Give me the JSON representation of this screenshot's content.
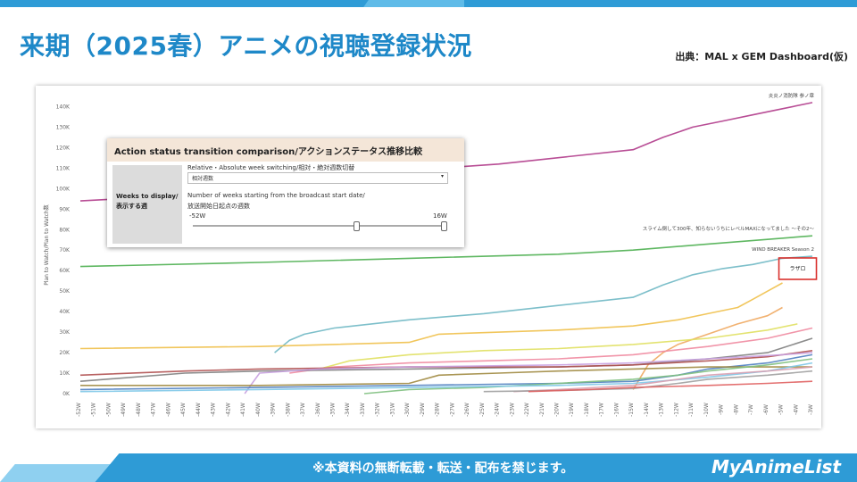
{
  "slide": {
    "title": "来期（2025春）アニメの視聴登録状況",
    "source": "出典：MAL x GEM Dashboard(仮)",
    "footnote": "※本資料の無断転載・転送・配布を禁じます。",
    "brand": "MyAnimeList",
    "accent_color": "#1e88c8",
    "band_color": "#2e9bd6"
  },
  "panel": {
    "title": "Action status transition comparison/アクションステータス推移比較",
    "side_label": "Weeks to display/ 表示する週",
    "switch_label": "Relative・Absolute week switching/相対・絶対週数切替",
    "switch_value": "相対週数",
    "weeks_label_1": "Number of weeks starting from the broadcast start date/",
    "weeks_label_2": "放送開始日起点の週数",
    "range_min": "-52W",
    "range_max": "16W",
    "range_from": -52,
    "range_to": 16
  },
  "chart_data": {
    "type": "line",
    "ylabel": "Plan to Watch/Plan to Watch数",
    "xlabel": "",
    "x": [
      -52,
      -51,
      -50,
      -49,
      -48,
      -47,
      -46,
      -45,
      -44,
      -43,
      -42,
      -41,
      -40,
      -39,
      -38,
      -37,
      -36,
      -35,
      -34,
      -33,
      -32,
      -31,
      -30,
      -29,
      -28,
      -27,
      -26,
      -25,
      -24,
      -23,
      -22,
      -21,
      -20,
      -19,
      -18,
      -17,
      -16,
      -15,
      -14,
      -13,
      -12,
      -11,
      -10,
      -9,
      -8,
      -7,
      -6,
      -5,
      -4,
      -3
    ],
    "x_tick_labels": [
      "-52W",
      "-51W",
      "-50W",
      "-49W",
      "-48W",
      "-47W",
      "-46W",
      "-45W",
      "-44W",
      "-43W",
      "-42W",
      "-41W",
      "-40W",
      "-39W",
      "-38W",
      "-37W",
      "-36W",
      "-35W",
      "-34W",
      "-33W",
      "-32W",
      "-31W",
      "-30W",
      "-29W",
      "-28W",
      "-27W",
      "-26W",
      "-25W",
      "-24W",
      "-23W",
      "-22W",
      "-21W",
      "-20W",
      "-19W",
      "-18W",
      "-17W",
      "-16W",
      "-15W",
      "-14W",
      "-13W",
      "-12W",
      "-11W",
      "-10W",
      "-9W",
      "-8W",
      "-7W",
      "-6W",
      "-5W",
      "-4W",
      "-3W"
    ],
    "y_tick_labels": [
      "0K",
      "10K",
      "20K",
      "30K",
      "40K",
      "50K",
      "60K",
      "70K",
      "80K",
      "90K",
      "100K",
      "110K",
      "120K",
      "130K",
      "140K"
    ],
    "ylim": [
      0,
      145000
    ],
    "grid": false,
    "highlight_box_label": "ラザロ",
    "highlight_color": "#d9302c",
    "series": [
      {
        "name": "炎炎ノ消防隊 参ノ章",
        "color": "#b03a8a",
        "label": "炎炎ノ消防隊 参ノ章",
        "points": [
          [
            -52,
            94000
          ],
          [
            -47,
            96000
          ],
          [
            -40,
            100000
          ],
          [
            -32,
            108000
          ],
          [
            -24,
            112000
          ],
          [
            -15,
            119000
          ],
          [
            -13,
            125000
          ],
          [
            -11,
            130000
          ],
          [
            -9,
            133000
          ],
          [
            -7,
            136000
          ],
          [
            -5,
            139000
          ],
          [
            -3,
            142000
          ]
        ]
      },
      {
        "name": "スライム倒して300年、知らないうちにレベルMAXになってました 〜その2〜",
        "color": "#4caf50",
        "label": "スライム倒して300年、知らないうちにレベルMAXになってました ～その2～",
        "points": [
          [
            -52,
            62000
          ],
          [
            -40,
            64000
          ],
          [
            -30,
            66000
          ],
          [
            -20,
            68000
          ],
          [
            -15,
            70000
          ],
          [
            -10,
            73000
          ],
          [
            -3,
            77000
          ]
        ]
      },
      {
        "name": "WIND BREAKER Season 2",
        "color": "#6fb8c4",
        "label": "WIND BREAKER Season 2",
        "points": [
          [
            -39,
            20000
          ],
          [
            -38,
            26000
          ],
          [
            -37,
            29000
          ],
          [
            -35,
            32000
          ],
          [
            -30,
            36000
          ],
          [
            -25,
            39000
          ],
          [
            -20,
            43000
          ],
          [
            -15,
            47000
          ],
          [
            -13,
            53000
          ],
          [
            -11,
            58000
          ],
          [
            -9,
            61000
          ],
          [
            -7,
            63000
          ],
          [
            -5,
            66000
          ],
          [
            -3,
            67000
          ]
        ]
      },
      {
        "name": "ラザロ",
        "color": "#f0c04a",
        "points": [
          [
            -52,
            22000
          ],
          [
            -40,
            23000
          ],
          [
            -30,
            25000
          ],
          [
            -28,
            29000
          ],
          [
            -20,
            31000
          ],
          [
            -15,
            33000
          ],
          [
            -12,
            36000
          ],
          [
            -10,
            39000
          ],
          [
            -8,
            42000
          ],
          [
            -7,
            46000
          ],
          [
            -6,
            50000
          ],
          [
            -5,
            54000
          ]
        ]
      },
      {
        "name": "",
        "color": "#f0a860",
        "points": [
          [
            -15,
            2000
          ],
          [
            -14,
            14000
          ],
          [
            -13,
            20000
          ],
          [
            -12,
            24000
          ],
          [
            -10,
            29000
          ],
          [
            -8,
            34000
          ],
          [
            -6,
            38000
          ],
          [
            -5,
            42000
          ]
        ]
      },
      {
        "name": "",
        "color": "#e0e060",
        "points": [
          [
            -36,
            12000
          ],
          [
            -34,
            16000
          ],
          [
            -30,
            19000
          ],
          [
            -25,
            21000
          ],
          [
            -20,
            22000
          ],
          [
            -15,
            24000
          ],
          [
            -10,
            27000
          ],
          [
            -6,
            31000
          ],
          [
            -4,
            34000
          ]
        ]
      },
      {
        "name": "",
        "color": "#f08aa0",
        "points": [
          [
            -38,
            10000
          ],
          [
            -35,
            13000
          ],
          [
            -30,
            15000
          ],
          [
            -25,
            16000
          ],
          [
            -20,
            17000
          ],
          [
            -15,
            19000
          ],
          [
            -10,
            23000
          ],
          [
            -6,
            27000
          ],
          [
            -3,
            32000
          ]
        ]
      },
      {
        "name": "",
        "color": "#808080",
        "points": [
          [
            -52,
            6000
          ],
          [
            -45,
            10000
          ],
          [
            -40,
            11000
          ],
          [
            -30,
            12000
          ],
          [
            -20,
            13000
          ],
          [
            -15,
            14000
          ],
          [
            -10,
            17000
          ],
          [
            -6,
            20000
          ],
          [
            -3,
            27000
          ]
        ]
      },
      {
        "name": "",
        "color": "#b05050",
        "points": [
          [
            -52,
            9000
          ],
          [
            -45,
            11000
          ],
          [
            -40,
            12000
          ],
          [
            -30,
            13000
          ],
          [
            -20,
            13000
          ],
          [
            -15,
            14000
          ],
          [
            -10,
            16000
          ],
          [
            -6,
            18000
          ],
          [
            -3,
            21000
          ]
        ]
      },
      {
        "name": "",
        "color": "#c8a0e0",
        "points": [
          [
            -41,
            0
          ],
          [
            -40,
            10000
          ],
          [
            -36,
            12000
          ],
          [
            -30,
            13000
          ],
          [
            -20,
            14000
          ],
          [
            -15,
            15000
          ],
          [
            -10,
            17000
          ],
          [
            -5,
            19000
          ],
          [
            -3,
            20000
          ]
        ]
      },
      {
        "name": "",
        "color": "#5080c0",
        "points": [
          [
            -52,
            2000
          ],
          [
            -40,
            3000
          ],
          [
            -30,
            4000
          ],
          [
            -20,
            5000
          ],
          [
            -15,
            6000
          ],
          [
            -12,
            9000
          ],
          [
            -10,
            12000
          ],
          [
            -6,
            15000
          ],
          [
            -3,
            19000
          ]
        ]
      },
      {
        "name": "",
        "color": "#a08a40",
        "points": [
          [
            -52,
            4000
          ],
          [
            -40,
            4000
          ],
          [
            -30,
            5000
          ],
          [
            -28,
            9000
          ],
          [
            -24,
            10000
          ],
          [
            -20,
            11000
          ],
          [
            -15,
            12000
          ],
          [
            -10,
            13000
          ],
          [
            -6,
            13000
          ],
          [
            -3,
            13000
          ]
        ]
      },
      {
        "name": "",
        "color": "#80c080",
        "points": [
          [
            -33,
            0
          ],
          [
            -30,
            2000
          ],
          [
            -25,
            3000
          ],
          [
            -20,
            5000
          ],
          [
            -15,
            7000
          ],
          [
            -12,
            9000
          ],
          [
            -10,
            11000
          ],
          [
            -6,
            14000
          ],
          [
            -3,
            17000
          ]
        ]
      },
      {
        "name": "",
        "color": "#7ec8e8",
        "points": [
          [
            -52,
            1000
          ],
          [
            -40,
            2000
          ],
          [
            -30,
            3000
          ],
          [
            -20,
            4000
          ],
          [
            -15,
            5000
          ],
          [
            -10,
            8000
          ],
          [
            -6,
            11000
          ],
          [
            -3,
            15000
          ]
        ]
      },
      {
        "name": "",
        "color": "#d8a0b0",
        "points": [
          [
            -23,
            1000
          ],
          [
            -20,
            2000
          ],
          [
            -15,
            4000
          ],
          [
            -12,
            7000
          ],
          [
            -10,
            9000
          ],
          [
            -6,
            11000
          ],
          [
            -3,
            13000
          ]
        ]
      },
      {
        "name": "",
        "color": "#a0a0a0",
        "points": [
          [
            -25,
            1000
          ],
          [
            -20,
            1500
          ],
          [
            -15,
            2500
          ],
          [
            -12,
            5000
          ],
          [
            -10,
            7000
          ],
          [
            -6,
            9000
          ],
          [
            -3,
            11000
          ]
        ]
      },
      {
        "name": "",
        "color": "#e06060",
        "points": [
          [
            -22,
            1000
          ],
          [
            -18,
            2000
          ],
          [
            -15,
            3000
          ],
          [
            -10,
            4000
          ],
          [
            -6,
            5000
          ],
          [
            -3,
            6000
          ]
        ]
      }
    ]
  }
}
